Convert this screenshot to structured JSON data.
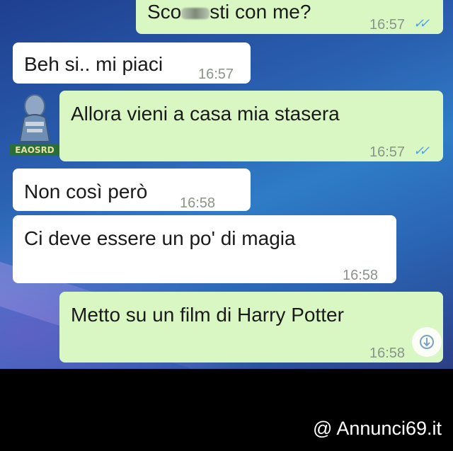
{
  "messages": [
    {
      "direction": "out",
      "text_before": "Sco",
      "text_after": "sti con me?",
      "time": "16:57",
      "status": "read"
    },
    {
      "direction": "in",
      "text": "Beh si.. mi piaci",
      "time": "16:57"
    },
    {
      "direction": "out",
      "text": "Allora vieni a casa mia stasera",
      "time": "16:57",
      "status": "read"
    },
    {
      "direction": "in",
      "text": "Non così però",
      "time": "16:58"
    },
    {
      "direction": "in",
      "text": "Ci deve essere un po' di magia",
      "time": "16:58"
    },
    {
      "direction": "out",
      "text": "Metto su un film di Harry Potter",
      "time": "16:58",
      "status": "read"
    }
  ],
  "avatar": {
    "label": "EAOSRD"
  },
  "watermark": "@ Annunci69.it",
  "icons": {
    "read_ticks": "double-check-icon",
    "scroll": "scroll-down-icon"
  },
  "colors": {
    "outgoing_bubble": "#d9f7c3",
    "incoming_bubble": "#ffffff",
    "tick_blue": "#4fa3e6"
  }
}
